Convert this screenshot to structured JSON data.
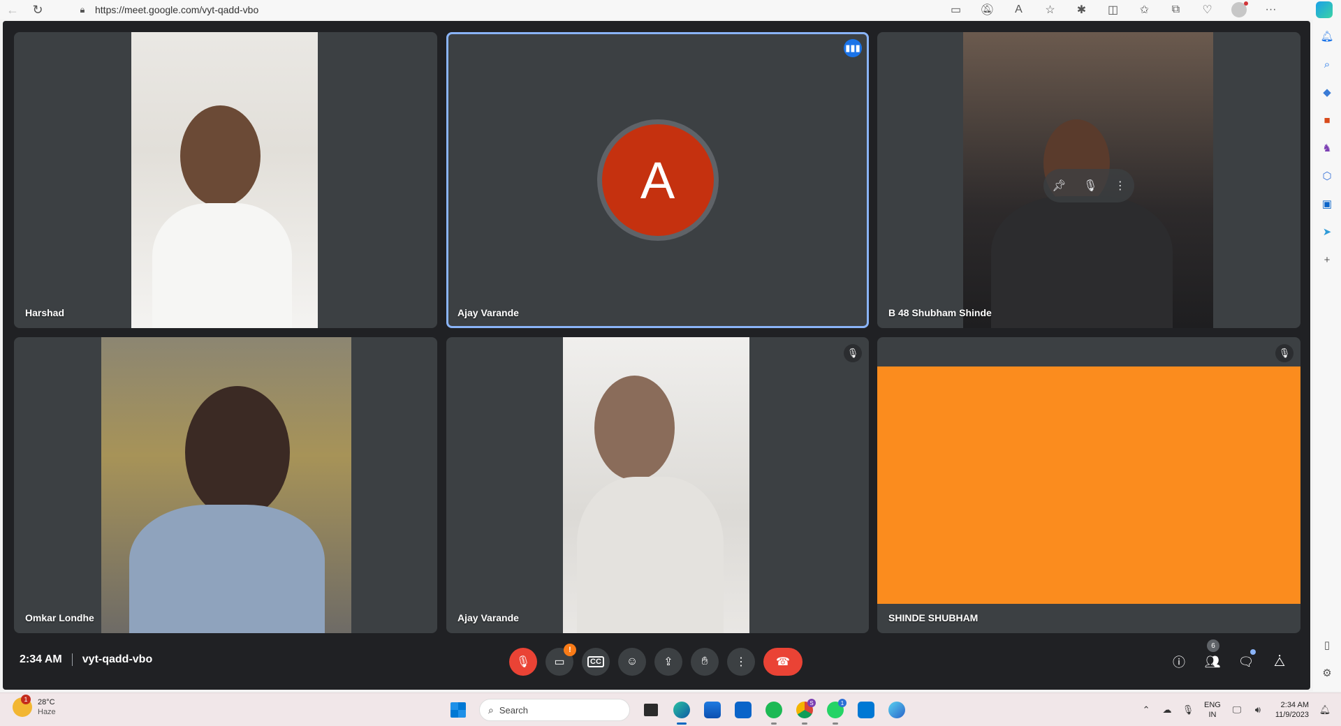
{
  "browser": {
    "url": "https://meet.google.com/vyt-qadd-vbo"
  },
  "tiles": [
    {
      "name": "Harshad"
    },
    {
      "name": "Ajay Varande",
      "avatar_letter": "A",
      "avatar_color": "#c5310f",
      "speaking": true
    },
    {
      "name": "B 48 Shubham Shinde"
    },
    {
      "name": "Omkar Londhe"
    },
    {
      "name": "Ajay Varande",
      "muted": true
    },
    {
      "name": "SHINDE SHUBHAM",
      "muted": true,
      "video_color": "#fb8c1e"
    }
  ],
  "meeting": {
    "time": "2:34 AM",
    "code": "vyt-qadd-vbo"
  },
  "controls": {
    "camera_warning": "!",
    "people_count": "6"
  },
  "taskbar": {
    "weather_temp": "28°C",
    "weather_desc": "Haze",
    "weather_badge": "1",
    "search_placeholder": "Search",
    "chrome_badge": "S",
    "whatsapp_badge": "1",
    "lang_top": "ENG",
    "lang_bottom": "IN",
    "clock_time": "2:34 AM",
    "clock_date": "11/9/2023"
  }
}
